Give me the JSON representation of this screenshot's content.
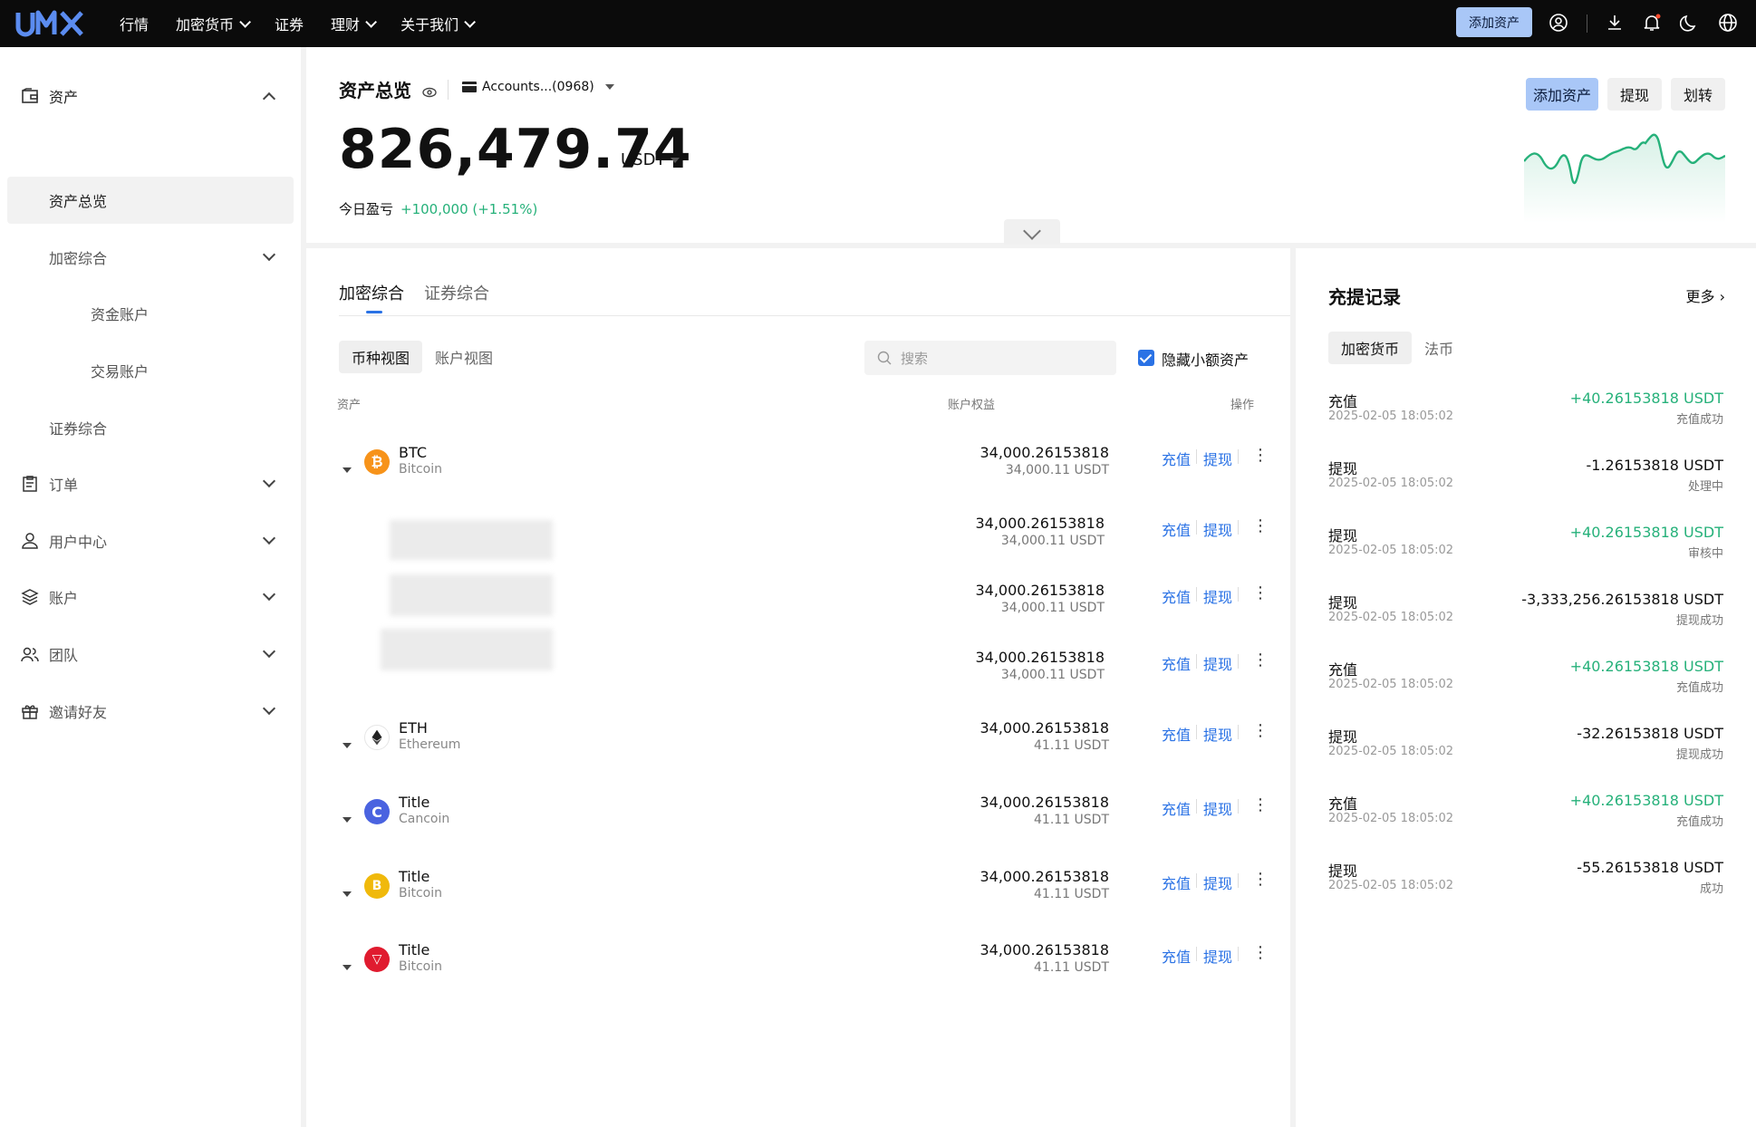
{
  "topbar": {
    "logo_text": "UMX",
    "nav": [
      "行情",
      "加密货币",
      "证券",
      "理财",
      "关于我们"
    ],
    "add_asset": "添加资产",
    "icons": [
      "user-icon",
      "download-icon",
      "bell-icon",
      "moon-icon",
      "globe-icon"
    ]
  },
  "sidebar": {
    "assets": "资产",
    "overview": "资产总览",
    "crypto": "加密综合",
    "fund_account": "资金账户",
    "trade_account": "交易账户",
    "securities": "证券综合",
    "orders": "订单",
    "user_center": "用户中心",
    "account": "账户",
    "team": "团队",
    "invite": "邀请好友"
  },
  "overview": {
    "title": "资产总览",
    "account": "Accounts...(0968)",
    "balance": "826,479.74",
    "unit": "USDT",
    "pnl_label": "今日盈亏",
    "pnl_value": "+100,000 (+1.51%)",
    "buttons": [
      "添加资产",
      "提现",
      "划转"
    ],
    "accent": "#26b17a"
  },
  "main": {
    "tabs": [
      "加密综合",
      "证券综合"
    ],
    "views": [
      "币种视图",
      "账户视图"
    ],
    "search_placeholder": "搜索",
    "hide_small": "隐藏小额资产",
    "headers": [
      "资产",
      "账户权益",
      "操作"
    ],
    "deposit": "充值",
    "withdraw": "提现",
    "rows": [
      {
        "symbol": "BTC",
        "name": "Bitcoin",
        "v1": "34,000.26153818",
        "v2": "34,000.11 USDT",
        "color": "#f7931a",
        "glyph": "₿"
      },
      {
        "symbol": "",
        "name": "",
        "v1": "34,000.26153818",
        "v2": "34,000.11 USDT"
      },
      {
        "symbol": "",
        "name": "",
        "v1": "34,000.26153818",
        "v2": "34,000.11 USDT"
      },
      {
        "symbol": "",
        "name": "",
        "v1": "34,000.26153818",
        "v2": "34,000.11 USDT"
      },
      {
        "symbol": "ETH",
        "name": "Ethereum",
        "v1": "34,000.26153818",
        "v2": "41.11 USDT",
        "color": "#ffffff",
        "glyph": "◆"
      },
      {
        "symbol": "Title",
        "name": "Cancoin",
        "v1": "34,000.26153818",
        "v2": "41.11 USDT",
        "color": "#4a63e0",
        "glyph": "C"
      },
      {
        "symbol": "Title",
        "name": "Bitcoin",
        "v1": "34,000.26153818",
        "v2": "41.11 USDT",
        "color": "#f0b90b",
        "glyph": "B"
      },
      {
        "symbol": "Title",
        "name": "Bitcoin",
        "v1": "34,000.26153818",
        "v2": "41.11 USDT",
        "color": "#e01b2f",
        "glyph": "▽"
      }
    ]
  },
  "records": {
    "title": "充提记录",
    "more": "更多",
    "tabs": [
      "加密货币",
      "法币"
    ],
    "items": [
      {
        "type": "充值",
        "date": "2025-02-05 18:05:02",
        "amount": "+40.26153818 USDT",
        "status": "充值成功",
        "green": true
      },
      {
        "type": "提现",
        "date": "2025-02-05 18:05:02",
        "amount": "-1.26153818 USDT",
        "status": "处理中",
        "green": false
      },
      {
        "type": "提现",
        "date": "2025-02-05 18:05:02",
        "amount": "+40.26153818 USDT",
        "status": "审核中",
        "green": true
      },
      {
        "type": "提现",
        "date": "2025-02-05 18:05:02",
        "amount": "-3,333,256.26153818 USDT",
        "status": "提现成功",
        "green": false
      },
      {
        "type": "充值",
        "date": "2025-02-05 18:05:02",
        "amount": "+40.26153818 USDT",
        "status": "充值成功",
        "green": true
      },
      {
        "type": "提现",
        "date": "2025-02-05 18:05:02",
        "amount": "-32.26153818 USDT",
        "status": "提现成功",
        "green": false
      },
      {
        "type": "充值",
        "date": "2025-02-05 18:05:02",
        "amount": "+40.26153818 USDT",
        "status": "充值成功",
        "green": true
      },
      {
        "type": "提现",
        "date": "2025-02-05 18:05:02",
        "amount": "-55.26153818 USDT",
        "status": "成功",
        "green": false
      }
    ]
  }
}
